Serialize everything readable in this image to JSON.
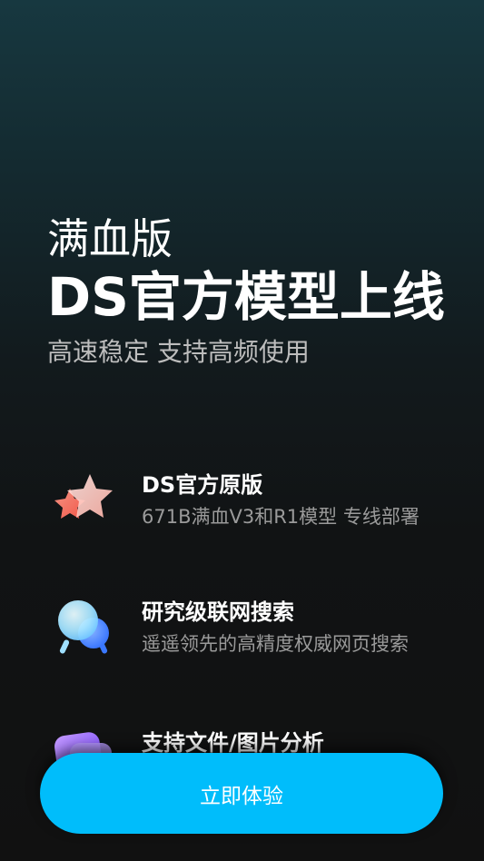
{
  "hero": {
    "line1": "满血版",
    "line2": "DS官方模型上线",
    "subtitle": "高速稳定 支持高频使用"
  },
  "features": [
    {
      "icon": "star-icon",
      "title": "DS官方原版",
      "description": "671B满血V3和R1模型 专线部署"
    },
    {
      "icon": "search-globe-icon",
      "title": "研究级联网搜索",
      "description": "遥遥领先的高精度权威网页搜索"
    },
    {
      "icon": "file-image-icon",
      "title": "支持文件/图片分析",
      "description": ""
    }
  ],
  "cta": {
    "label": "立即体验"
  },
  "colors": {
    "accent": "#00bdfb",
    "background": "#111111",
    "muted_text": "#9a9a9a"
  }
}
